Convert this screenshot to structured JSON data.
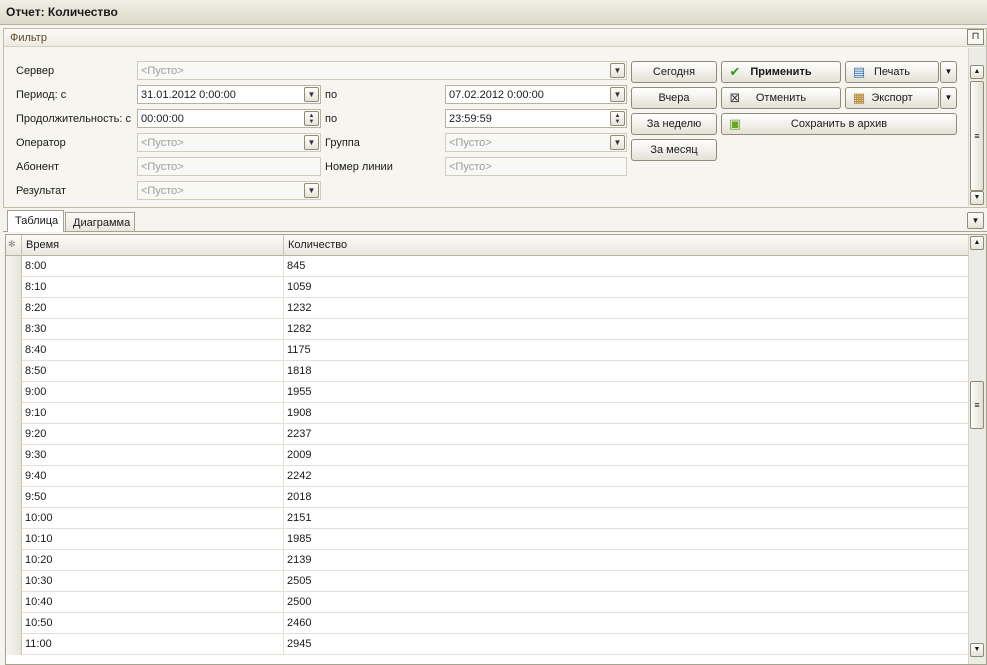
{
  "window": {
    "title": "Отчет: Количество"
  },
  "filter": {
    "header": "Фильтр",
    "pin_glyph": "⊓",
    "server": {
      "label": "Сервер",
      "placeholder": "<Пусто>"
    },
    "period": {
      "label": "Период: с",
      "from": "31.01.2012 0:00:00",
      "to_label": "по",
      "to": "07.02.2012 0:00:00"
    },
    "duration": {
      "label": "Продолжительность: с",
      "from": "00:00:00",
      "to_label": "по",
      "to": "23:59:59"
    },
    "operator": {
      "label": "Оператор",
      "placeholder": "<Пусто>"
    },
    "group": {
      "label": "Группа",
      "placeholder": "<Пусто>"
    },
    "subscriber": {
      "label": "Абонент",
      "placeholder": "<Пусто>"
    },
    "line_number": {
      "label": "Номер линии",
      "placeholder": "<Пусто>"
    },
    "result": {
      "label": "Результат",
      "placeholder": "<Пусто>"
    },
    "quick": {
      "today": "Сегодня",
      "yesterday": "Вчера",
      "week": "За неделю",
      "month": "За месяц"
    },
    "actions": {
      "apply": "Применить",
      "cancel": "Отменить",
      "print": "Печать",
      "export": "Экспорт",
      "archive": "Сохранить в архив"
    }
  },
  "tabs": [
    {
      "label": "Таблица"
    },
    {
      "label": "Диаграмма"
    }
  ],
  "grid": {
    "indicator_glyph": "✻",
    "columns": [
      "Время",
      "Количество"
    ],
    "rows": [
      {
        "time": "8:00",
        "count": "845"
      },
      {
        "time": "8:10",
        "count": "1059"
      },
      {
        "time": "8:20",
        "count": "1232"
      },
      {
        "time": "8:30",
        "count": "1282"
      },
      {
        "time": "8:40",
        "count": "1175"
      },
      {
        "time": "8:50",
        "count": "1818"
      },
      {
        "time": "9:00",
        "count": "1955"
      },
      {
        "time": "9:10",
        "count": "1908"
      },
      {
        "time": "9:20",
        "count": "2237"
      },
      {
        "time": "9:30",
        "count": "2009"
      },
      {
        "time": "9:40",
        "count": "2242"
      },
      {
        "time": "9:50",
        "count": "2018"
      },
      {
        "time": "10:00",
        "count": "2151"
      },
      {
        "time": "10:10",
        "count": "1985"
      },
      {
        "time": "10:20",
        "count": "2139"
      },
      {
        "time": "10:30",
        "count": "2505"
      },
      {
        "time": "10:40",
        "count": "2500"
      },
      {
        "time": "10:50",
        "count": "2460"
      },
      {
        "time": "11:00",
        "count": "2945"
      }
    ]
  },
  "icons": {
    "apply": "check-icon",
    "cancel": "x-box-icon",
    "print": "printer-icon",
    "export": "briefcase-icon",
    "archive": "archive-box-icon"
  },
  "colors": {
    "apply_check": "#2e9b1f",
    "panel_bg": "#f4f3ee",
    "border": "#a7a28f"
  }
}
